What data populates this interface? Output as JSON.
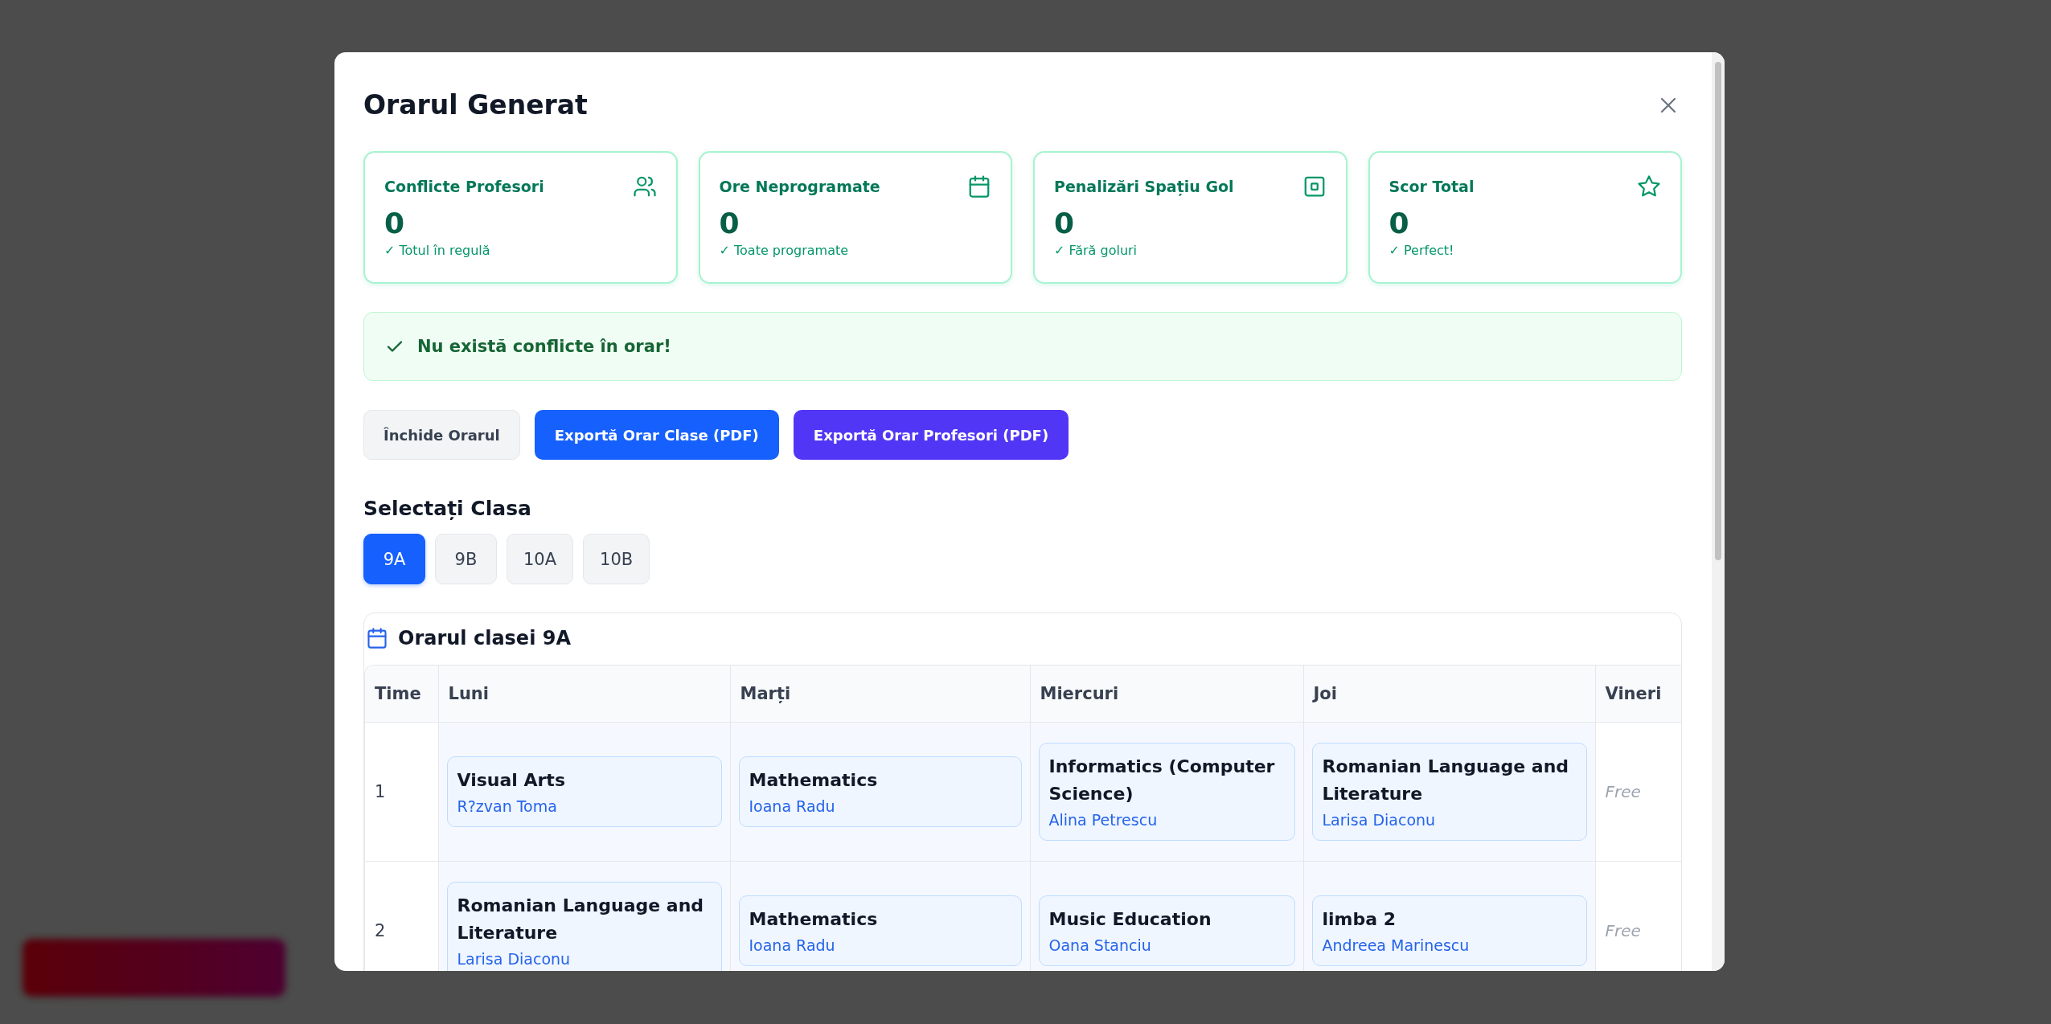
{
  "modal": {
    "title": "Orarul Generat"
  },
  "stats": [
    {
      "kind": "users",
      "label": "Conflicte Profesori",
      "value": "0",
      "note": "✓ Totul în regulă"
    },
    {
      "kind": "calendar",
      "label": "Ore Neprogramate",
      "value": "0",
      "note": "✓ Toate programate"
    },
    {
      "kind": "square",
      "label": "Penalizări Spațiu Gol",
      "value": "0",
      "note": "✓ Fără goluri"
    },
    {
      "kind": "star",
      "label": "Scor Total",
      "value": "0",
      "note": "✓ Perfect!"
    }
  ],
  "alert": {
    "text": "Nu există conflicte în orar!"
  },
  "buttons": [
    {
      "kind": "secondary",
      "label": "Închide Orarul"
    },
    {
      "kind": "primary",
      "label": "Exportă Orar Clase (PDF)"
    },
    {
      "kind": "accent",
      "label": "Exportă Orar Profesori (PDF)"
    }
  ],
  "class_selector": {
    "heading": "Selectați Clasa",
    "classes": [
      {
        "label": "9A",
        "selected": true
      },
      {
        "label": "9B",
        "selected": false
      },
      {
        "label": "10A",
        "selected": false
      },
      {
        "label": "10B",
        "selected": false
      }
    ]
  },
  "table": {
    "title": "Orarul clasei 9A",
    "columns": [
      "Time",
      "Luni",
      "Marți",
      "Miercuri",
      "Joi",
      "Vineri"
    ],
    "rows": [
      {
        "cells": [
          {
            "kind": "time",
            "text": "1"
          },
          {
            "kind": "lesson",
            "subject": "Visual Arts",
            "teacher": "R?zvan Toma"
          },
          {
            "kind": "lesson",
            "subject": "Mathematics",
            "teacher": "Ioana Radu"
          },
          {
            "kind": "lesson",
            "subject": "Informatics (Computer Science)",
            "teacher": "Alina Petrescu"
          },
          {
            "kind": "lesson",
            "subject": "Romanian Language and Literature",
            "teacher": "Larisa Diaconu"
          },
          {
            "kind": "free",
            "label": "Free"
          }
        ]
      },
      {
        "cells": [
          {
            "kind": "time",
            "text": "2"
          },
          {
            "kind": "lesson",
            "subject": "Romanian Language and Literature",
            "teacher": "Larisa Diaconu"
          },
          {
            "kind": "lesson",
            "subject": "Mathematics",
            "teacher": "Ioana Radu"
          },
          {
            "kind": "lesson",
            "subject": "Music Education",
            "teacher": "Oana Stanciu"
          },
          {
            "kind": "lesson",
            "subject": "limba 2",
            "teacher": "Andreea Marinescu"
          },
          {
            "kind": "free",
            "label": "Free"
          }
        ]
      }
    ]
  }
}
